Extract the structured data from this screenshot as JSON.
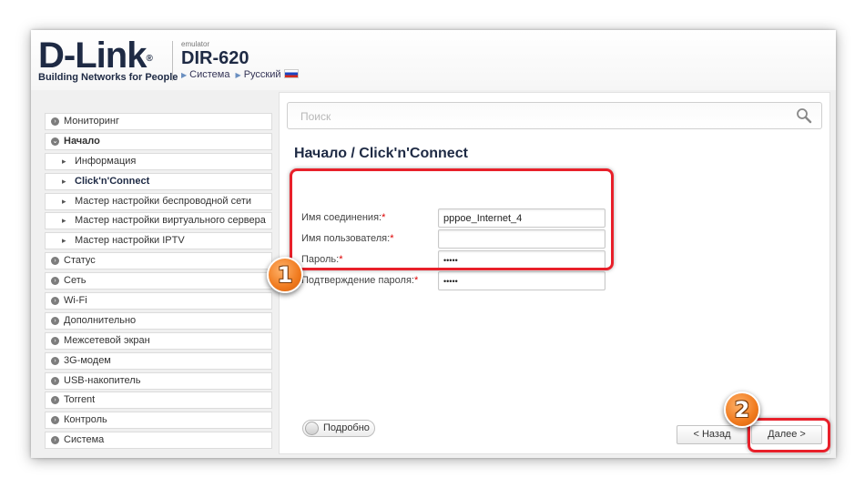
{
  "header": {
    "logo_text": "D-Link",
    "logo_reg": "®",
    "tagline": "Building Networks for People",
    "emulator_label": "emulator",
    "model": "DIR-620",
    "breadcrumb_system": "Система",
    "breadcrumb_language": "Русский"
  },
  "sidebar": {
    "items": [
      {
        "label": "Мониторинг"
      },
      {
        "label": "Начало"
      },
      {
        "label": "Информация"
      },
      {
        "label": "Click'n'Connect"
      },
      {
        "label": "Мастер настройки беспроводной сети"
      },
      {
        "label": "Мастер настройки виртуального сервера"
      },
      {
        "label": "Мастер настройки IPTV"
      },
      {
        "label": "Статус"
      },
      {
        "label": "Сеть"
      },
      {
        "label": "Wi-Fi"
      },
      {
        "label": "Дополнительно"
      },
      {
        "label": "Межсетевой экран"
      },
      {
        "label": "3G-модем"
      },
      {
        "label": "USB-накопитель"
      },
      {
        "label": "Torrent"
      },
      {
        "label": "Контроль"
      },
      {
        "label": "Система"
      }
    ]
  },
  "search": {
    "placeholder": "Поиск"
  },
  "page": {
    "title": "Начало /  Click'n'Connect"
  },
  "form": {
    "connection_name_label": "Имя соединения:",
    "connection_name_value": "pppoe_Internet_4",
    "username_label": "Имя пользователя:",
    "username_value": "",
    "password_label": "Пароль:",
    "password_value": "•••••",
    "confirm_label": "Подтверждение пароля:",
    "confirm_value": "•••••",
    "required_mark": "*"
  },
  "controls": {
    "details_toggle": "Подробно",
    "back_button": "< Назад",
    "next_button": "Далее >"
  },
  "annotations": {
    "badge_1": "1",
    "badge_2": "2",
    "highlight_color": "#e8202a",
    "badge_color": "#f07a1e"
  },
  "colors": {
    "brand_navy": "#1e2a44",
    "required": "#dd0000"
  }
}
